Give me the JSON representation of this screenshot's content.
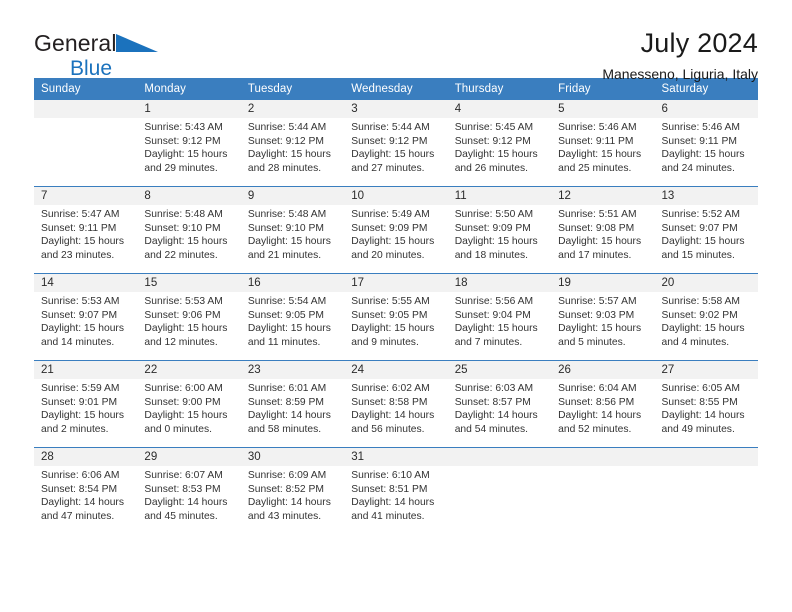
{
  "brand": {
    "name_part1": "General",
    "name_part2": "Blue",
    "triangle_color": "#1b72bd"
  },
  "header": {
    "title": "July 2024",
    "subtitle": "Manesseno, Liguria, Italy"
  },
  "theme": {
    "header_blue": "#3a7ebf",
    "daynum_band": "#f2f2f2",
    "text": "#333333"
  },
  "weekdays": [
    "Sunday",
    "Monday",
    "Tuesday",
    "Wednesday",
    "Thursday",
    "Friday",
    "Saturday"
  ],
  "weeks": [
    [
      {
        "day": "",
        "sunrise": "",
        "sunset": "",
        "daylight1": "",
        "daylight2": ""
      },
      {
        "day": "1",
        "sunrise": "Sunrise: 5:43 AM",
        "sunset": "Sunset: 9:12 PM",
        "daylight1": "Daylight: 15 hours",
        "daylight2": "and 29 minutes."
      },
      {
        "day": "2",
        "sunrise": "Sunrise: 5:44 AM",
        "sunset": "Sunset: 9:12 PM",
        "daylight1": "Daylight: 15 hours",
        "daylight2": "and 28 minutes."
      },
      {
        "day": "3",
        "sunrise": "Sunrise: 5:44 AM",
        "sunset": "Sunset: 9:12 PM",
        "daylight1": "Daylight: 15 hours",
        "daylight2": "and 27 minutes."
      },
      {
        "day": "4",
        "sunrise": "Sunrise: 5:45 AM",
        "sunset": "Sunset: 9:12 PM",
        "daylight1": "Daylight: 15 hours",
        "daylight2": "and 26 minutes."
      },
      {
        "day": "5",
        "sunrise": "Sunrise: 5:46 AM",
        "sunset": "Sunset: 9:11 PM",
        "daylight1": "Daylight: 15 hours",
        "daylight2": "and 25 minutes."
      },
      {
        "day": "6",
        "sunrise": "Sunrise: 5:46 AM",
        "sunset": "Sunset: 9:11 PM",
        "daylight1": "Daylight: 15 hours",
        "daylight2": "and 24 minutes."
      }
    ],
    [
      {
        "day": "7",
        "sunrise": "Sunrise: 5:47 AM",
        "sunset": "Sunset: 9:11 PM",
        "daylight1": "Daylight: 15 hours",
        "daylight2": "and 23 minutes."
      },
      {
        "day": "8",
        "sunrise": "Sunrise: 5:48 AM",
        "sunset": "Sunset: 9:10 PM",
        "daylight1": "Daylight: 15 hours",
        "daylight2": "and 22 minutes."
      },
      {
        "day": "9",
        "sunrise": "Sunrise: 5:48 AM",
        "sunset": "Sunset: 9:10 PM",
        "daylight1": "Daylight: 15 hours",
        "daylight2": "and 21 minutes."
      },
      {
        "day": "10",
        "sunrise": "Sunrise: 5:49 AM",
        "sunset": "Sunset: 9:09 PM",
        "daylight1": "Daylight: 15 hours",
        "daylight2": "and 20 minutes."
      },
      {
        "day": "11",
        "sunrise": "Sunrise: 5:50 AM",
        "sunset": "Sunset: 9:09 PM",
        "daylight1": "Daylight: 15 hours",
        "daylight2": "and 18 minutes."
      },
      {
        "day": "12",
        "sunrise": "Sunrise: 5:51 AM",
        "sunset": "Sunset: 9:08 PM",
        "daylight1": "Daylight: 15 hours",
        "daylight2": "and 17 minutes."
      },
      {
        "day": "13",
        "sunrise": "Sunrise: 5:52 AM",
        "sunset": "Sunset: 9:07 PM",
        "daylight1": "Daylight: 15 hours",
        "daylight2": "and 15 minutes."
      }
    ],
    [
      {
        "day": "14",
        "sunrise": "Sunrise: 5:53 AM",
        "sunset": "Sunset: 9:07 PM",
        "daylight1": "Daylight: 15 hours",
        "daylight2": "and 14 minutes."
      },
      {
        "day": "15",
        "sunrise": "Sunrise: 5:53 AM",
        "sunset": "Sunset: 9:06 PM",
        "daylight1": "Daylight: 15 hours",
        "daylight2": "and 12 minutes."
      },
      {
        "day": "16",
        "sunrise": "Sunrise: 5:54 AM",
        "sunset": "Sunset: 9:05 PM",
        "daylight1": "Daylight: 15 hours",
        "daylight2": "and 11 minutes."
      },
      {
        "day": "17",
        "sunrise": "Sunrise: 5:55 AM",
        "sunset": "Sunset: 9:05 PM",
        "daylight1": "Daylight: 15 hours",
        "daylight2": "and 9 minutes."
      },
      {
        "day": "18",
        "sunrise": "Sunrise: 5:56 AM",
        "sunset": "Sunset: 9:04 PM",
        "daylight1": "Daylight: 15 hours",
        "daylight2": "and 7 minutes."
      },
      {
        "day": "19",
        "sunrise": "Sunrise: 5:57 AM",
        "sunset": "Sunset: 9:03 PM",
        "daylight1": "Daylight: 15 hours",
        "daylight2": "and 5 minutes."
      },
      {
        "day": "20",
        "sunrise": "Sunrise: 5:58 AM",
        "sunset": "Sunset: 9:02 PM",
        "daylight1": "Daylight: 15 hours",
        "daylight2": "and 4 minutes."
      }
    ],
    [
      {
        "day": "21",
        "sunrise": "Sunrise: 5:59 AM",
        "sunset": "Sunset: 9:01 PM",
        "daylight1": "Daylight: 15 hours",
        "daylight2": "and 2 minutes."
      },
      {
        "day": "22",
        "sunrise": "Sunrise: 6:00 AM",
        "sunset": "Sunset: 9:00 PM",
        "daylight1": "Daylight: 15 hours",
        "daylight2": "and 0 minutes."
      },
      {
        "day": "23",
        "sunrise": "Sunrise: 6:01 AM",
        "sunset": "Sunset: 8:59 PM",
        "daylight1": "Daylight: 14 hours",
        "daylight2": "and 58 minutes."
      },
      {
        "day": "24",
        "sunrise": "Sunrise: 6:02 AM",
        "sunset": "Sunset: 8:58 PM",
        "daylight1": "Daylight: 14 hours",
        "daylight2": "and 56 minutes."
      },
      {
        "day": "25",
        "sunrise": "Sunrise: 6:03 AM",
        "sunset": "Sunset: 8:57 PM",
        "daylight1": "Daylight: 14 hours",
        "daylight2": "and 54 minutes."
      },
      {
        "day": "26",
        "sunrise": "Sunrise: 6:04 AM",
        "sunset": "Sunset: 8:56 PM",
        "daylight1": "Daylight: 14 hours",
        "daylight2": "and 52 minutes."
      },
      {
        "day": "27",
        "sunrise": "Sunrise: 6:05 AM",
        "sunset": "Sunset: 8:55 PM",
        "daylight1": "Daylight: 14 hours",
        "daylight2": "and 49 minutes."
      }
    ],
    [
      {
        "day": "28",
        "sunrise": "Sunrise: 6:06 AM",
        "sunset": "Sunset: 8:54 PM",
        "daylight1": "Daylight: 14 hours",
        "daylight2": "and 47 minutes."
      },
      {
        "day": "29",
        "sunrise": "Sunrise: 6:07 AM",
        "sunset": "Sunset: 8:53 PM",
        "daylight1": "Daylight: 14 hours",
        "daylight2": "and 45 minutes."
      },
      {
        "day": "30",
        "sunrise": "Sunrise: 6:09 AM",
        "sunset": "Sunset: 8:52 PM",
        "daylight1": "Daylight: 14 hours",
        "daylight2": "and 43 minutes."
      },
      {
        "day": "31",
        "sunrise": "Sunrise: 6:10 AM",
        "sunset": "Sunset: 8:51 PM",
        "daylight1": "Daylight: 14 hours",
        "daylight2": "and 41 minutes."
      },
      {
        "day": "",
        "sunrise": "",
        "sunset": "",
        "daylight1": "",
        "daylight2": ""
      },
      {
        "day": "",
        "sunrise": "",
        "sunset": "",
        "daylight1": "",
        "daylight2": ""
      },
      {
        "day": "",
        "sunrise": "",
        "sunset": "",
        "daylight1": "",
        "daylight2": ""
      }
    ]
  ]
}
